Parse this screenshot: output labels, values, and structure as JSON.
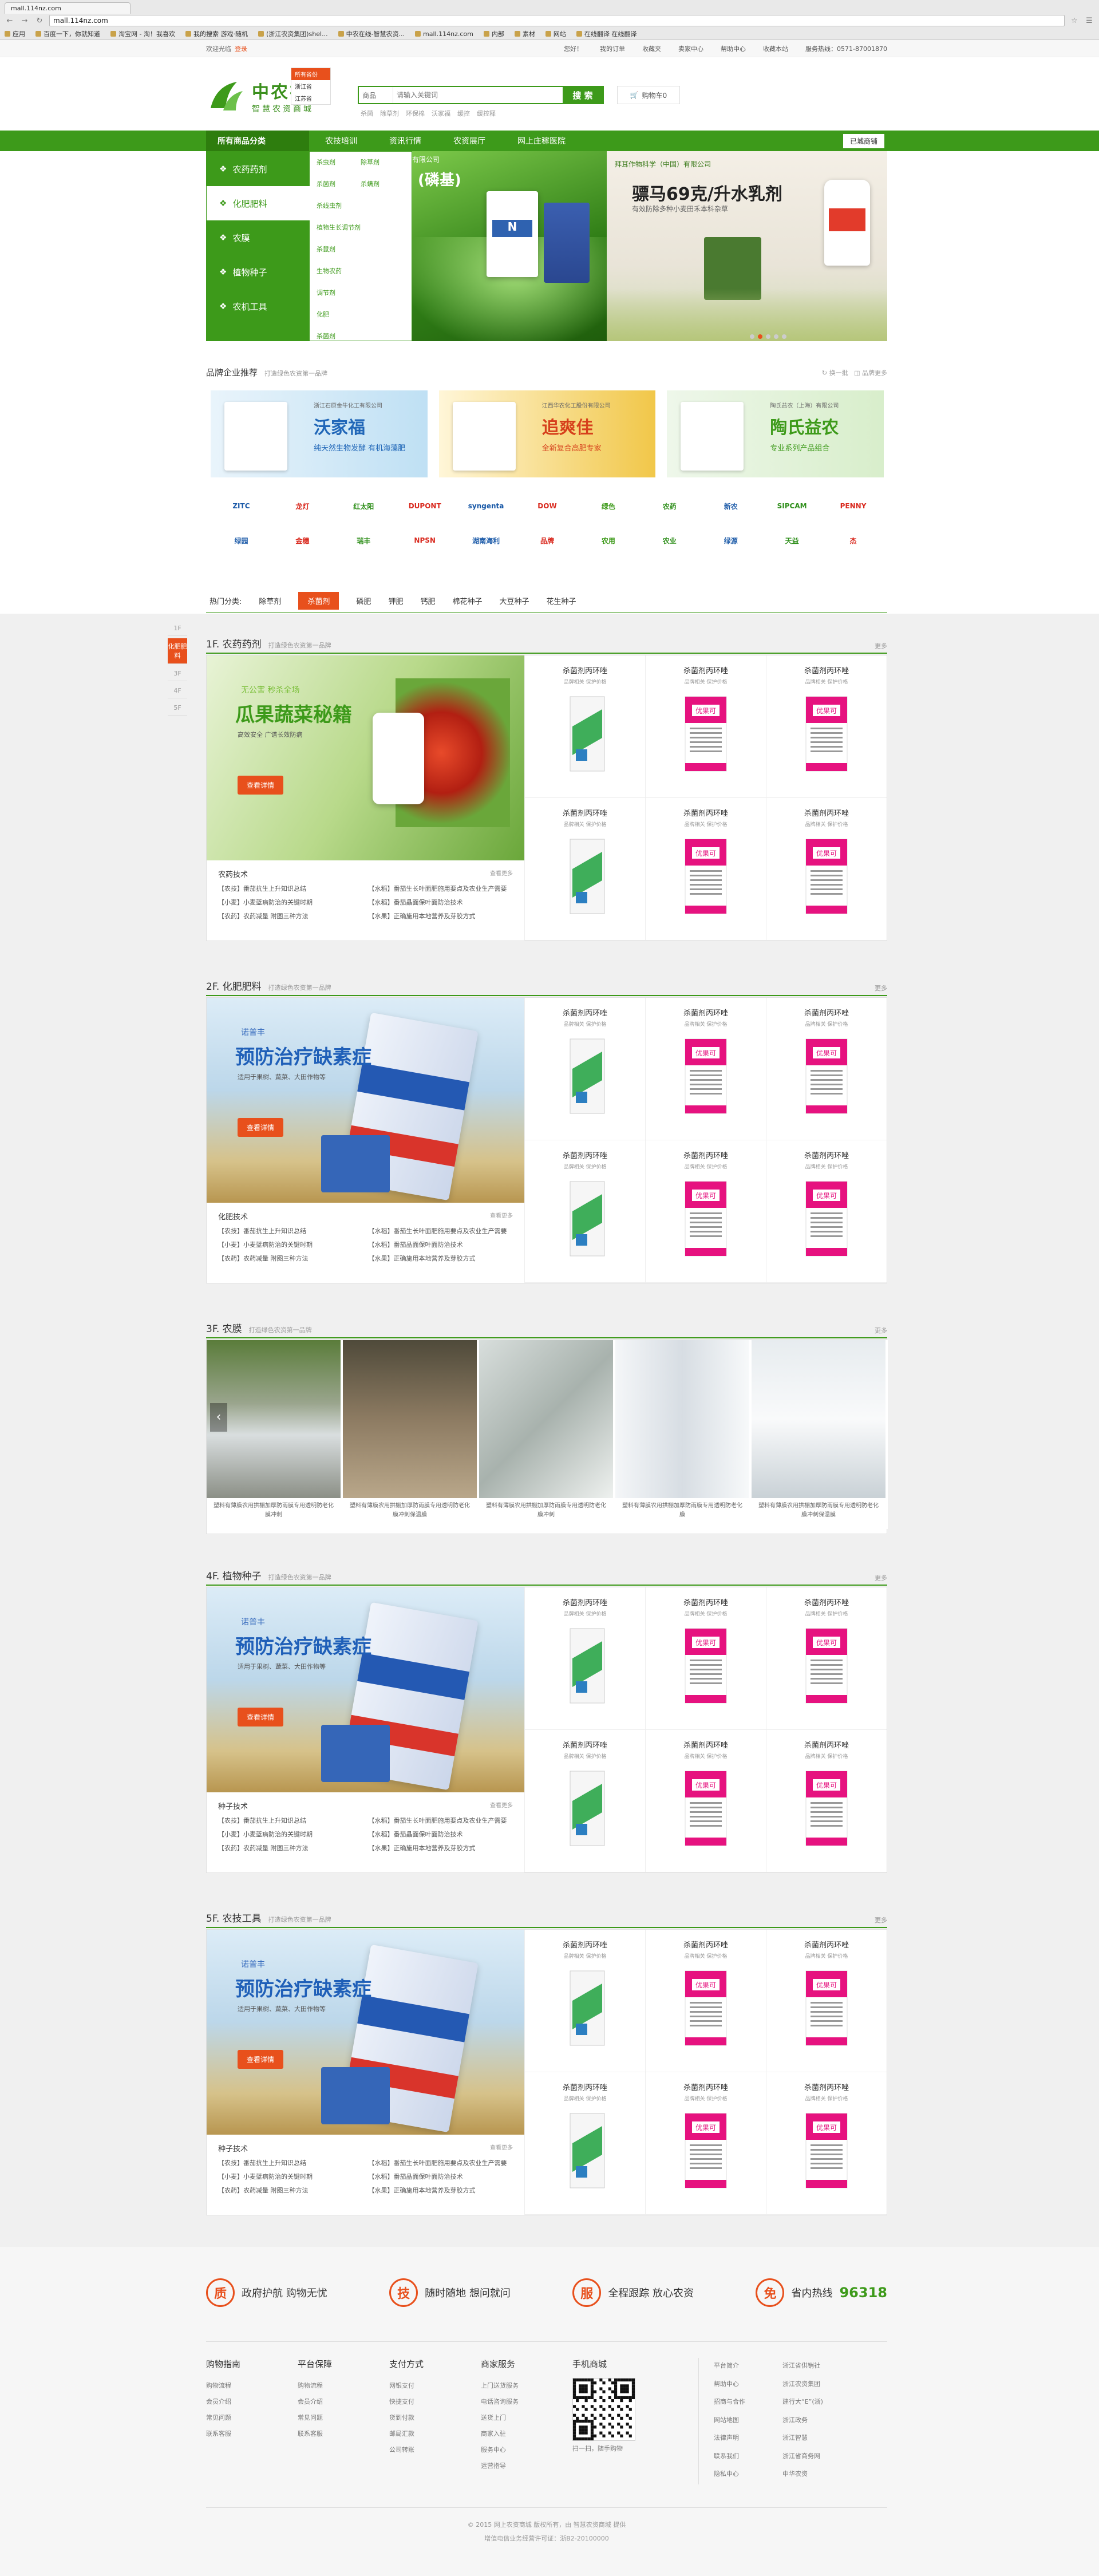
{
  "browser": {
    "tab_title": "mall.114nz.com",
    "url": "mall.114nz.com",
    "bookmarks": [
      "应用",
      "百度一下，你就知道",
      "淘宝网 - 淘！我喜欢",
      "我的搜索 游戏·随机",
      "(浙江农资集团)shel...",
      "中农在线-智慧农资...",
      "mall.114nz.com",
      "内部",
      "素材",
      "网站",
      "在线翻译 在线翻译"
    ]
  },
  "topbar": {
    "welcome": "欢迎光临",
    "login": "登录",
    "links": [
      "您好！",
      "我的订单",
      "收藏夹",
      "卖家中心",
      "帮助中心",
      "收藏本站",
      "服务热线：0571-87001870"
    ],
    "location_popup": [
      "所有省份",
      "浙江省",
      "江苏省"
    ]
  },
  "header": {
    "logo_title": "中农在线",
    "logo_sub": "智慧农资商城",
    "search_type": "商品",
    "search_placeholder": "请输入关键词",
    "search_button": "搜 索",
    "hotwords": [
      "杀菌",
      "除草剂",
      "环保棉",
      "沃家福",
      "缓控",
      "缓控释"
    ],
    "cart": "购物车0"
  },
  "nav": {
    "allcat": "所有商品分类",
    "items": [
      "农技培训",
      "资讯行情",
      "农资展厅",
      "网上庄稼医院"
    ],
    "city": "已城商铺"
  },
  "categories": [
    {
      "label": "农药药剂",
      "icon": "leaf-icon"
    },
    {
      "label": "化肥肥料",
      "icon": "fertilizer-icon"
    },
    {
      "label": "农膜",
      "icon": "film-icon"
    },
    {
      "label": "植物种子",
      "icon": "seed-icon"
    },
    {
      "label": "农机工具",
      "icon": "tool-icon"
    }
  ],
  "subcats": [
    "杀虫剂",
    "除草剂",
    "杀菌剂",
    "杀螨剂",
    "杀线虫剂",
    "",
    "植物生长调节剂",
    "",
    "杀鼠剂",
    "",
    "生物农药",
    "",
    "调节剂",
    "",
    "化肥",
    "",
    "杀菌剂",
    ""
  ],
  "banner": {
    "slide1_brand": "有限公司",
    "slide1_text": "(磷基)",
    "slide2_company": "拜耳作物科学（中国）有限公司",
    "slide2_title": "骠马69克/升水乳剂",
    "slide2_sub": "有效防除多种小麦田禾本科杂草",
    "dots": 5,
    "active_dot": 1
  },
  "brand": {
    "title": "品牌企业推荐",
    "sub": "打造绿色农资第一品牌",
    "prev": "换一批",
    "more": "品牌更多",
    "ads": [
      {
        "company": "浙江石原金牛化工有限公司",
        "name": "沃家福",
        "desc": "纯天然生物发酵 有机海藻肥"
      },
      {
        "company": "江西华农化工股份有限公司",
        "name": "追爽佳",
        "desc": "全新复合高肥专家"
      },
      {
        "company": "陶氏益农（上海）有限公司",
        "name": "陶氏益农",
        "desc": "专业系列产品组合"
      }
    ],
    "logos": [
      "ZITC",
      "龙灯",
      "红太阳",
      "DUPONT",
      "syngenta",
      "DOW",
      "绿色",
      "农药",
      "新农",
      "SIPCAM",
      "PENNY",
      "绿园",
      "金穗",
      "瑞丰",
      "NPSN",
      "湖南海利",
      "品牌",
      "农用",
      "农业",
      "绿源",
      "天益",
      "杰"
    ]
  },
  "hot": {
    "label": "热门分类:",
    "items": [
      "除草剂",
      "杀菌剂",
      "磷肥",
      "钾肥",
      "钙肥",
      "棉花种子",
      "大豆种子",
      "花生种子"
    ],
    "active": 1
  },
  "floornav": [
    "1F",
    "化肥肥料",
    "3F",
    "4F",
    "5F"
  ],
  "floors": [
    {
      "id": "1F",
      "title": "1F. 农药药剂",
      "sub": "打造绿色农资第一品牌",
      "more": "更多",
      "banner_small": "无公害 秒杀全场",
      "banner_title": "瓜果蔬菜秘籍",
      "banner_desc": "高效安全 广谱长效防病",
      "cta": "查看详情",
      "news_title": "农药技术",
      "news_more": "查看更多",
      "news": [
        "【农技】番茄抗生上升知识总结",
        "【水稻】番茄生长叶面肥施用要点及农业生产需要",
        "【小麦】小麦蓝病防治的关键时期",
        "【水稻】番茄晶面保叶面防治技术",
        "【农药】农药减量 附图三种方法",
        "【水果】正确施用本地营养及芽胶方式"
      ]
    },
    {
      "id": "2F",
      "title": "2F. 化肥肥料",
      "sub": "打造绿色农资第一品牌",
      "more": "更多",
      "banner_small": "诺普丰",
      "banner_title": "预防治疗缺素症",
      "banner_desc": "适用于果树、蔬菜、大田作物等",
      "cta": "查看详情",
      "news_title": "化肥技术",
      "news_more": "查看更多",
      "news": [
        "【农技】番茄抗生上升知识总结",
        "【水稻】番茄生长叶面肥施用要点及农业生产需要",
        "【小麦】小麦蓝病防治的关键时期",
        "【水稻】番茄晶面保叶面防治技术",
        "【农药】农药减量 附图三种方法",
        "【水果】正确施用本地营养及芽胶方式"
      ]
    },
    {
      "id": "4F",
      "title": "4F. 植物种子",
      "sub": "打造绿色农资第一品牌",
      "more": "更多",
      "banner_small": "诺普丰",
      "banner_title": "预防治疗缺素症",
      "banner_desc": "适用于果树、蔬菜、大田作物等",
      "cta": "查看详情",
      "news_title": "种子技术",
      "news_more": "查看更多",
      "news": [
        "【农技】番茄抗生上升知识总结",
        "【水稻】番茄生长叶面肥施用要点及农业生产需要",
        "【小麦】小麦蓝病防治的关键时期",
        "【水稻】番茄晶面保叶面防治技术",
        "【农药】农药减量 附图三种方法",
        "【水果】正确施用本地营养及芽胶方式"
      ]
    },
    {
      "id": "5F",
      "title": "5F. 农技工具",
      "sub": "打造绿色农资第一品牌",
      "more": "更多",
      "banner_small": "诺普丰",
      "banner_title": "预防治疗缺素症",
      "banner_desc": "适用于果树、蔬菜、大田作物等",
      "cta": "查看详情",
      "news_title": "种子技术",
      "news_more": "查看更多",
      "news": [
        "【农技】番茄抗生上升知识总结",
        "【水稻】番茄生长叶面肥施用要点及农业生产需要",
        "【小麦】小麦蓝病防治的关键时期",
        "【水稻】番茄晶面保叶面防治技术",
        "【农药】农药减量 附图三种方法",
        "【水果】正确施用本地营养及芽胶方式"
      ]
    }
  ],
  "product": {
    "name": "杀菌剂丙环唑",
    "sub": "品牌相关 保护价格",
    "label": "优果可"
  },
  "film_floor": {
    "title": "3F. 农膜",
    "sub": "打造绿色农资第一品牌",
    "more": "更多",
    "items": [
      "塑料有薄膜农用拱棚加厚防雨膜专用透明防老化膜冲刺",
      "塑料有薄膜农用拱棚加厚防雨膜专用透明防老化膜冲刺保温膜",
      "塑料有薄膜农用拱棚加厚防雨膜专用透明防老化膜冲刺",
      "塑料有薄膜农用拱棚加厚防雨膜专用透明防老化膜",
      "塑料有薄膜农用拱棚加厚防雨膜专用透明防老化膜冲刺保温膜"
    ]
  },
  "service": [
    {
      "icon": "质",
      "text": "政府护航 购物无忧"
    },
    {
      "icon": "技",
      "text": "随时随地 想问就问"
    },
    {
      "icon": "服",
      "text": "全程跟踪 放心农资"
    },
    {
      "icon": "免",
      "text": "省内热线",
      "phone": "96318"
    }
  ],
  "footer": {
    "cols": [
      {
        "h": "购物指南",
        "items": [
          "购物流程",
          "会员介绍",
          "常见问题",
          "联系客服"
        ]
      },
      {
        "h": "平台保障",
        "items": [
          "购物流程",
          "会员介绍",
          "常见问题",
          "联系客服"
        ]
      },
      {
        "h": "支付方式",
        "items": [
          "网银支付",
          "快捷支付",
          "货到付款",
          "邮局汇款",
          "公司转账"
        ]
      },
      {
        "h": "商家服务",
        "items": [
          "上门送货服务",
          "电话咨询服务",
          "送货上门",
          "商家入驻",
          "服务中心",
          "运营指导"
        ]
      }
    ],
    "mobile_title": "手机商城",
    "mobile_caption": "扫一扫，随手购物",
    "links": [
      "平台简介",
      "浙江省供销社",
      "帮助中心",
      "浙江农资集团",
      "招商与合作",
      "建行大“E”(浙)",
      "网站地图",
      "浙江政务",
      "法律声明",
      "浙江智慧",
      "联系我们",
      "浙江省商务网",
      "隐私中心",
      "中华农资"
    ],
    "copyright": "© 2015 网上农资商城 版权所有，由 智慧农资商城 提供",
    "icp": "增值电信业务经营许可证：浙B2-20100000"
  }
}
